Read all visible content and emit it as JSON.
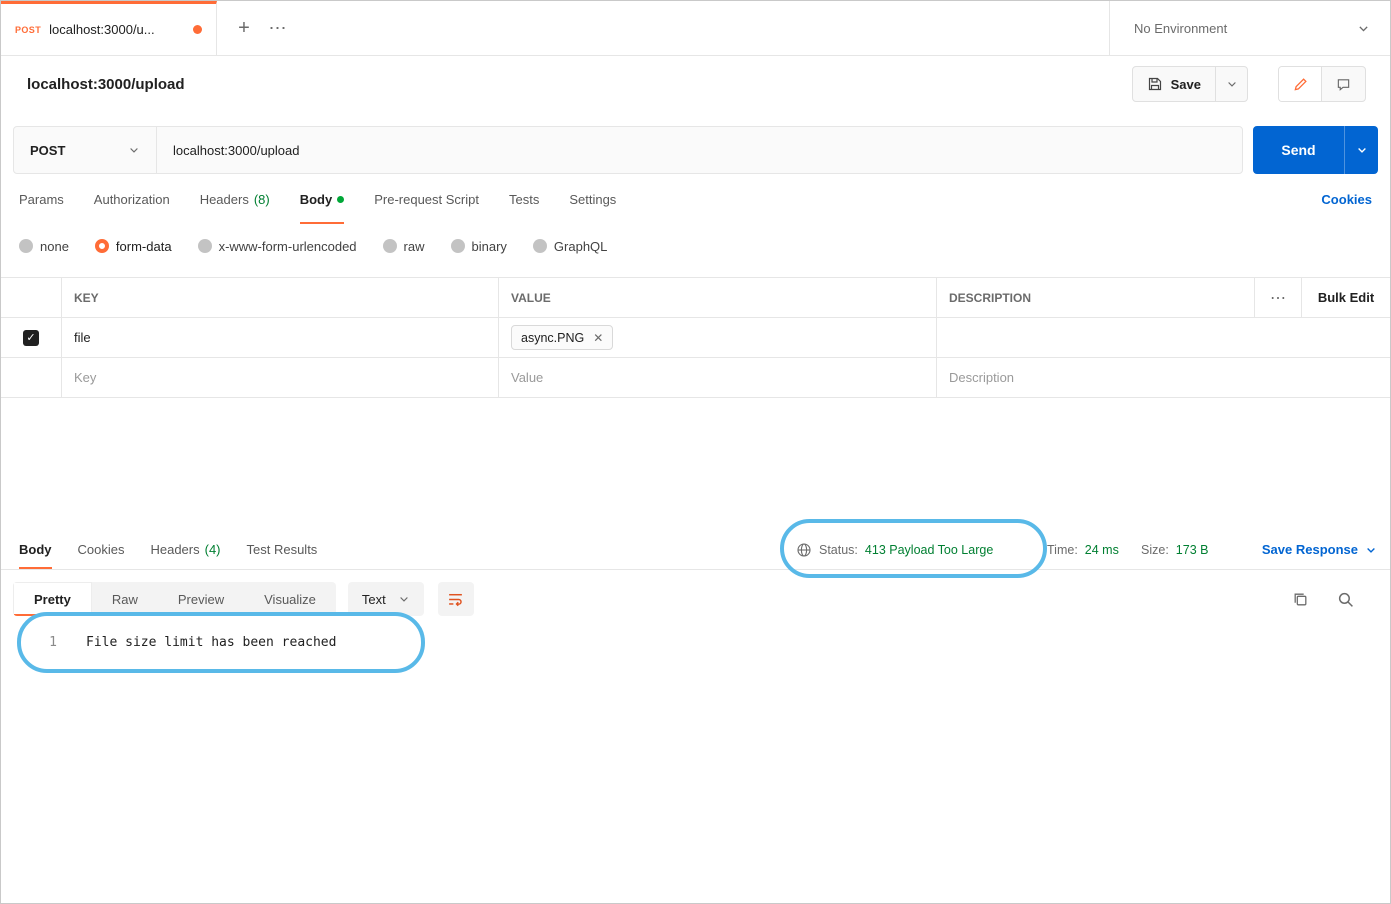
{
  "icons": {
    "plus": "+",
    "more_dots": "⋯",
    "close": "✕",
    "check": "✓"
  },
  "tabbar": {
    "tab_method": "POST",
    "tab_title": "localhost:3000/u...",
    "environment": "No Environment"
  },
  "header": {
    "title": "localhost:3000/upload",
    "save_label": "Save"
  },
  "request": {
    "method": "POST",
    "url": "localhost:3000/upload",
    "send_label": "Send",
    "tabs": [
      {
        "label": "Params",
        "count": ""
      },
      {
        "label": "Authorization",
        "count": ""
      },
      {
        "label": "Headers",
        "count": "(8)"
      },
      {
        "label": "Body",
        "count": ""
      },
      {
        "label": "Pre-request Script",
        "count": ""
      },
      {
        "label": "Tests",
        "count": ""
      },
      {
        "label": "Settings",
        "count": ""
      }
    ],
    "cookies_link": "Cookies",
    "modes": [
      "none",
      "form-data",
      "x-www-form-urlencoded",
      "raw",
      "binary",
      "GraphQL"
    ],
    "selected_mode": "form-data"
  },
  "table": {
    "col_key": "KEY",
    "col_value": "VALUE",
    "col_description": "DESCRIPTION",
    "bulk_edit": "Bulk Edit",
    "row1": {
      "key": "file",
      "file_chip": "async.PNG",
      "description": ""
    },
    "placeholders": {
      "key": "Key",
      "value": "Value",
      "description": "Description"
    }
  },
  "response": {
    "tabs": [
      {
        "label": "Body",
        "count": ""
      },
      {
        "label": "Cookies",
        "count": ""
      },
      {
        "label": "Headers",
        "count": "(4)"
      },
      {
        "label": "Test Results",
        "count": ""
      }
    ],
    "status_label": "Status:",
    "status_value": "413 Payload Too Large",
    "time_label": "Time:",
    "time_value": "24 ms",
    "size_label": "Size:",
    "size_value": "173 B",
    "save_response_label": "Save Response",
    "views": [
      "Pretty",
      "Raw",
      "Preview",
      "Visualize"
    ],
    "active_view": "Pretty",
    "format_select": "Text",
    "body": {
      "line_number": "1",
      "text": "File size limit has been reached"
    }
  },
  "colors": {
    "accent_orange": "#FF6C37",
    "primary_blue": "#0265D2",
    "success_green": "#007F31",
    "annotation_blue": "#59B9E8"
  }
}
